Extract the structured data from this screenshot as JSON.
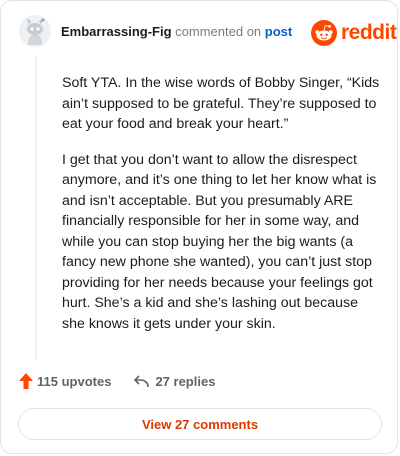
{
  "header": {
    "username": "Embarrassing-Fig",
    "action_text": "commented on",
    "post_link": "post",
    "logo_text": "reddit",
    "avatar_icon": "reddit-snoo-avatar-icon",
    "logo_icon": "reddit-snoo-logo-icon"
  },
  "comment": {
    "paragraphs": [
      "Soft YTA. In the wise words of Bobby Singer, “Kids ain’t supposed to be grateful. They’re supposed to eat your food and break your heart.”",
      "I get that you don’t want to allow the disrespect anymore, and it’s one thing to let her know what is and isn’t acceptable. But you presumably ARE financially responsible for her in some way, and while you can stop buying her the big wants (a fancy new phone she wanted), you can’t just stop providing for her needs because your feelings got hurt. She’s a kid and she’s lashing out because she knows it gets under your skin."
    ]
  },
  "actions": {
    "upvotes": "115 upvotes",
    "replies": "27 replies",
    "upvote_icon": "upvote-arrow-icon",
    "reply_icon": "reply-arrow-icon"
  },
  "view_comments_button": "View 27 comments",
  "colors": {
    "brand": "#ff4500",
    "link": "#0a5fcc",
    "button_text": "#d93a00"
  }
}
